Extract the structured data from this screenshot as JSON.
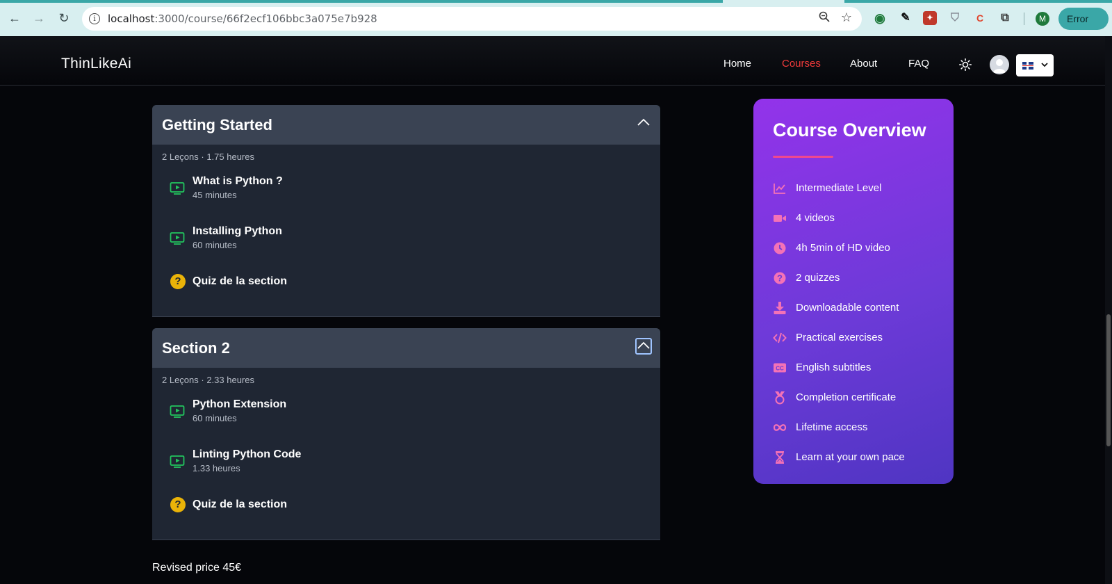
{
  "browser": {
    "url_host": "localhost",
    "url_path": ":3000/course/66f2ecf106bbc3a075e7b928",
    "profile_initial": "M",
    "error_label": "Error"
  },
  "header": {
    "brand": "ThinLikeAi",
    "nav": {
      "home": "Home",
      "courses": "Courses",
      "about": "About",
      "faq": "FAQ"
    },
    "active_color": "#ef3a3a"
  },
  "sections": [
    {
      "title": "Getting Started",
      "meta": "2 Leçons · 1.75 heures",
      "lessons": [
        {
          "title": "What is Python ?",
          "duration": "45 minutes"
        },
        {
          "title": "Installing Python",
          "duration": "60 minutes"
        }
      ],
      "quiz": "Quiz de la section"
    },
    {
      "title": "Section 2",
      "meta": "2 Leçons · 2.33 heures",
      "lessons": [
        {
          "title": "Python Extension",
          "duration": "60 minutes"
        },
        {
          "title": "Linting Python Code",
          "duration": "1.33 heures"
        }
      ],
      "quiz": "Quiz de la section"
    }
  ],
  "price_text": "Revised price 45€",
  "overview": {
    "title": "Course Overview",
    "items": [
      {
        "icon": "chart-line-icon",
        "label": "Intermediate Level"
      },
      {
        "icon": "video-camera-icon",
        "label": "4 videos"
      },
      {
        "icon": "clock-icon",
        "label": "4h 5min of HD video"
      },
      {
        "icon": "question-circle-icon",
        "label": "2 quizzes"
      },
      {
        "icon": "download-icon",
        "label": "Downloadable content"
      },
      {
        "icon": "code-icon",
        "label": "Practical exercises"
      },
      {
        "icon": "closed-captions-icon",
        "label": "English subtitles"
      },
      {
        "icon": "medal-icon",
        "label": "Completion certificate"
      },
      {
        "icon": "infinity-icon",
        "label": "Lifetime access"
      },
      {
        "icon": "hourglass-icon",
        "label": "Learn at your own pace"
      }
    ],
    "accent": "#f0488e"
  }
}
